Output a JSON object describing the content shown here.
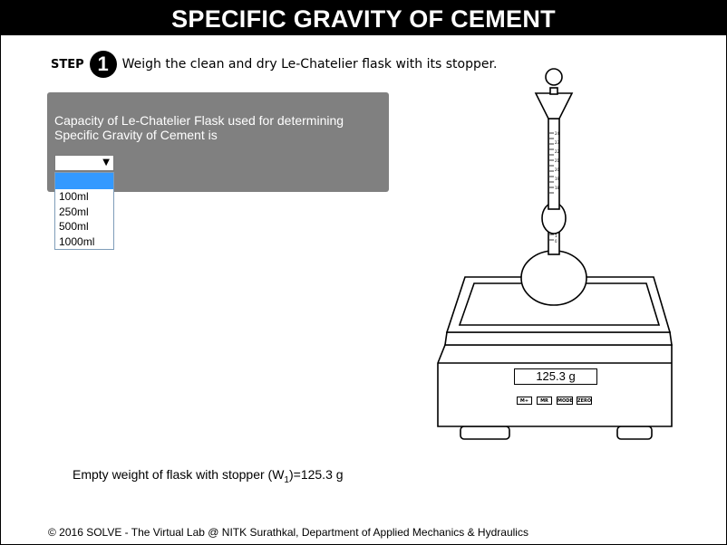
{
  "title": "SPECIFIC GRAVITY OF CEMENT",
  "step": {
    "word": "STEP",
    "number": "1",
    "instruction": "Weigh the clean and dry Le-Chatelier flask with its stopper."
  },
  "panel": {
    "question": "Capacity of Le-Chatelier Flask used for determining Specific Gravity of Cement is",
    "selected_value": "",
    "arrow": "▼",
    "options": [
      "",
      "100ml",
      "250ml",
      "500ml",
      "1000ml"
    ]
  },
  "balance": {
    "display": "125.3 g",
    "buttons": [
      "M+",
      "MR",
      "MODE",
      "ZERO"
    ],
    "flask_scale_top": [
      "24",
      "23",
      "22",
      "21",
      "20",
      "19",
      "18"
    ],
    "flask_scale_bottom": [
      "1",
      "0"
    ]
  },
  "result": {
    "prefix": "Empty weight of flask with stopper (W",
    "subscript": "1",
    "suffix": ")=125.3 g"
  },
  "footer": "© 2016 SOLVE - The Virtual Lab @ NITK Surathkal, Department of Applied Mechanics & Hydraulics",
  "colors": {
    "titlebar": "#000000",
    "panel": "#808080",
    "selected_option": "#3399ff"
  }
}
